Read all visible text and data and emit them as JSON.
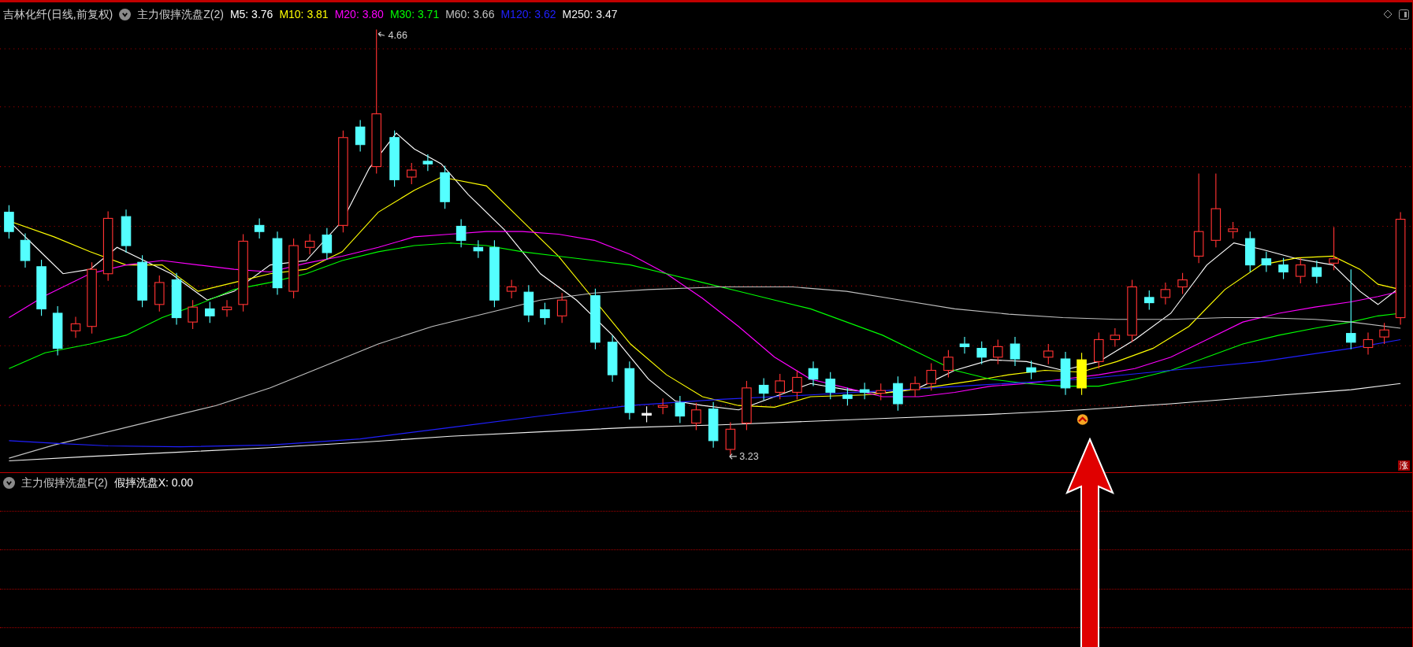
{
  "main_panel": {
    "stock_title": "吉林化纤(日线,前复权)",
    "indicator": "主力假摔洗盘Z(2)",
    "moving_averages": [
      {
        "label": "M5: 3.76",
        "color": "#ffffff"
      },
      {
        "label": "M10: 3.81",
        "color": "#ffff00"
      },
      {
        "label": "M20: 3.80",
        "color": "#ff00ff"
      },
      {
        "label": "M30: 3.71",
        "color": "#00ff00"
      },
      {
        "label": "M60: 3.66",
        "color": "#c0c0c0"
      },
      {
        "label": "M120: 3.62",
        "color": "#2020ff"
      },
      {
        "label": "M250: 3.47",
        "color": "#f0f0f0"
      }
    ],
    "high_label": "4.66",
    "low_label": "3.23",
    "badge": "涨"
  },
  "sub_panel": {
    "indicator": "主力假摔洗盘F(2)",
    "value": "假摔洗盘X: 0.00"
  }
}
